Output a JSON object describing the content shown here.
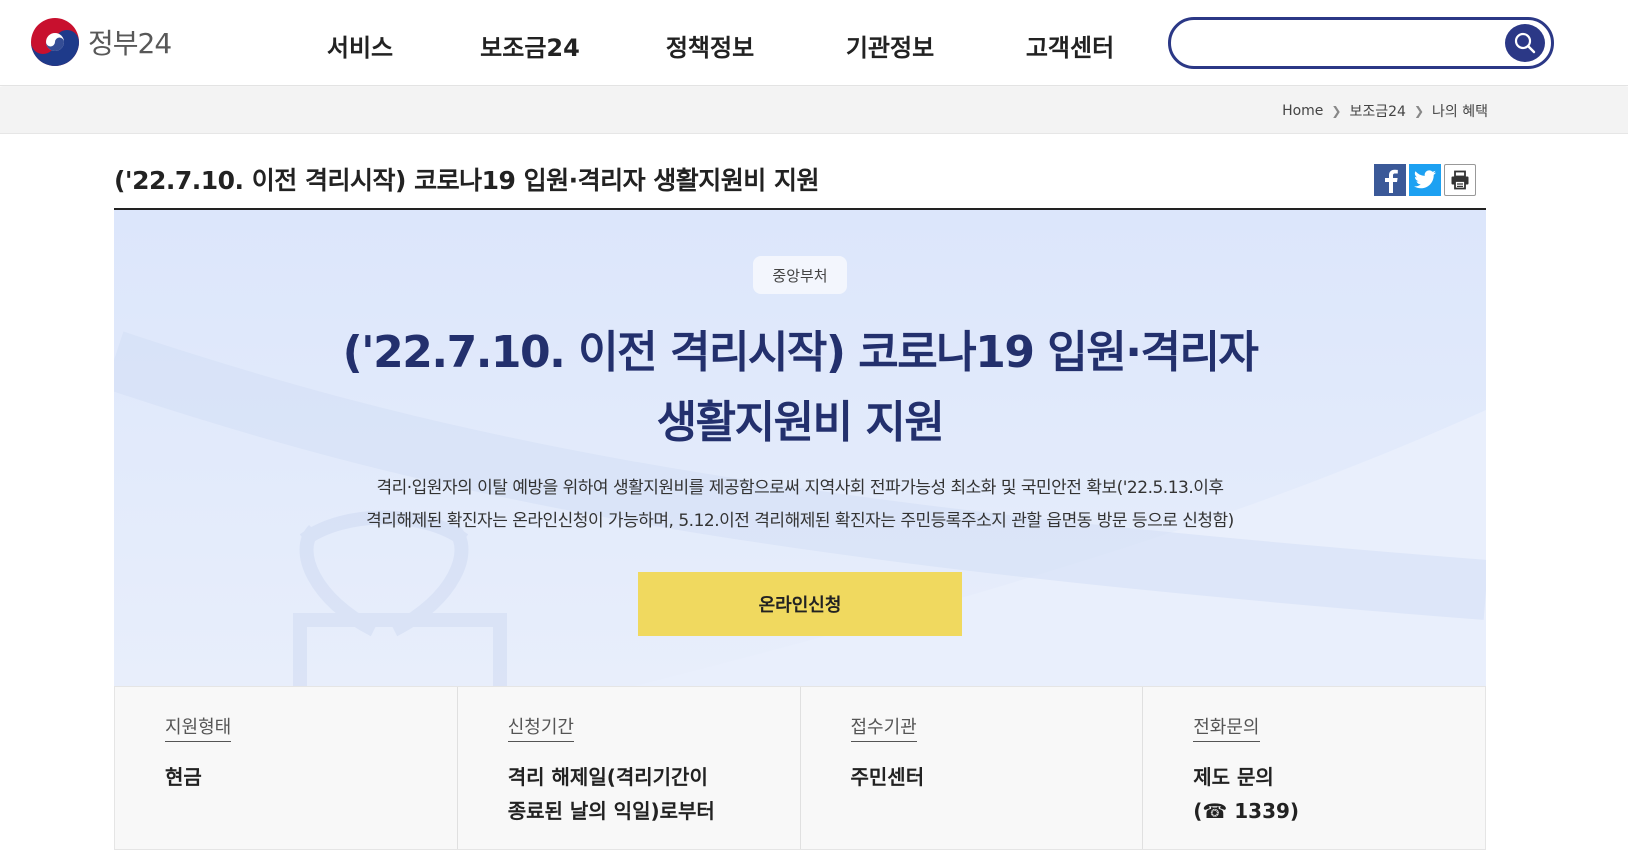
{
  "header": {
    "logo_text": "정부24",
    "nav": [
      "서비스",
      "보조금24",
      "정책정보",
      "기관정보",
      "고객센터"
    ],
    "search": {
      "value": "",
      "placeholder": ""
    }
  },
  "breadcrumb": [
    "Home",
    "보조금24",
    "나의 혜택"
  ],
  "page": {
    "title": "('22.7.10. 이전 격리시작) 코로나19 입원·격리자 생활지원비 지원"
  },
  "share": {
    "icons": [
      "facebook-icon",
      "twitter-icon",
      "print-icon"
    ]
  },
  "hero": {
    "badge": "중앙부처",
    "title_line1": "('22.7.10. 이전 격리시작) 코로나19 입원·격리자",
    "title_line2": "생활지원비 지원",
    "desc_line1": "격리·입원자의 이탈 예방을 위하여 생활지원비를 제공함으로써 지역사회 전파가능성 최소화 및 국민안전 확보('22.5.13.이후",
    "desc_line2": "격리해제된 확진자는 온라인신청이 가능하며, 5.12.이전 격리해제된 확진자는 주민등록주소지 관할 읍면동 방문 등으로 신청함)",
    "apply_button": "온라인신청"
  },
  "info": [
    {
      "label": "지원형태",
      "value_lines": [
        "현금"
      ]
    },
    {
      "label": "신청기간",
      "value_lines": [
        "격리 해제일(격리기간이",
        "종료된 날의 익일)로부터"
      ]
    },
    {
      "label": "접수기관",
      "value_lines": [
        "주민센터"
      ]
    },
    {
      "label": "전화문의",
      "value_lines": [
        "제도 문의",
        "(☎ 1339)"
      ]
    }
  ],
  "colors": {
    "brand_navy": "#2b3886",
    "hero_title": "#23306d",
    "apply_button": "#f0d95f",
    "hero_bg": "#dce6fb",
    "facebook": "#3b5998",
    "twitter": "#1da1f2"
  }
}
